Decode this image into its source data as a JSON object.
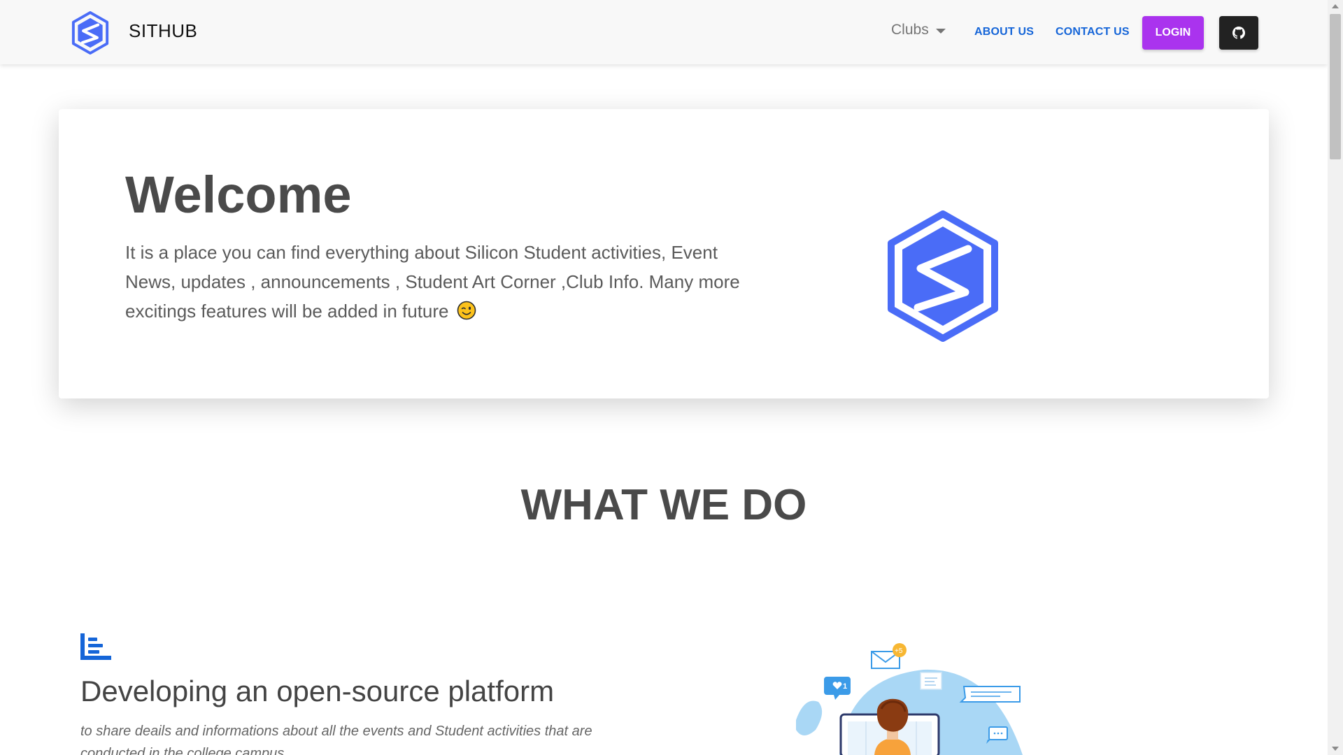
{
  "navbar": {
    "brand_name": "SITHUB",
    "clubs_label": "Clubs",
    "about_label": "ABOUT US",
    "contact_label": "CONTACT US",
    "login_label": "LOGIN"
  },
  "hero": {
    "title": "Welcome",
    "text": "It is a place you can find everything about Silicon Student activities, Event News, updates , announcements , Student Art Corner ,Club Info. Many more excitings features will be added in future"
  },
  "section": {
    "title": "WHAT WE DO"
  },
  "feature": {
    "title": "Developing an open-source platform",
    "text": "to share deails and informations about all the events and Student activities that are conducted in the college campus."
  },
  "illustration": {
    "like_count": "1",
    "mail_count": "+5"
  },
  "colors": {
    "brand_blue": "#4a6cf7",
    "login_purple": "#aa33ee",
    "link_blue": "#1565d8",
    "github_dark": "#222222"
  },
  "icons": {
    "brand_logo": "hexagon-s-logo",
    "github": "github-icon",
    "emoji": "winking-face",
    "feature": "bar-chart-icon"
  }
}
